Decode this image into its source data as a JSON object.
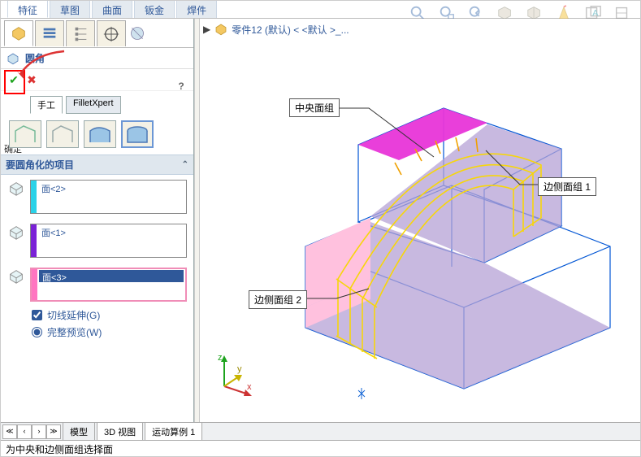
{
  "menu_tabs": {
    "feature": "特征",
    "sketch": "草图",
    "surface": "曲面",
    "sheetmetal": "钣金",
    "weld": "焊件"
  },
  "feature": {
    "name": "圆角",
    "ok_label": "确定"
  },
  "sub_tabs": {
    "manual": "手工",
    "xpert": "FilletXpert"
  },
  "section": {
    "items": "要圆角化的项目"
  },
  "faces": {
    "f1": "面<2>",
    "f2": "面<1>",
    "f3": "面<3>"
  },
  "options": {
    "tangent": "切线延伸(G)",
    "fullpreview": "完整预览(W)"
  },
  "breadcrumb": {
    "part": "零件12 (默认) < <默认 >_..."
  },
  "callouts": {
    "center": "中央面组",
    "side1": "边侧面组 1",
    "side2": "边侧面组 2"
  },
  "bottom_tabs": {
    "model": "模型",
    "view3d": "3D 视图",
    "motion": "运动算例 1"
  },
  "status": {
    "text": "为中央和边侧面组选择面"
  },
  "triad": {
    "x": "x",
    "y": "y",
    "z": "z"
  }
}
